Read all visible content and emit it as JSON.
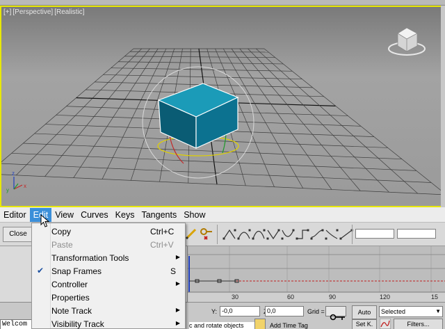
{
  "viewport": {
    "label_parts": [
      "[+]",
      "[Perspective]",
      "[Realistic]"
    ]
  },
  "menubar": {
    "items": [
      "Editor",
      "Edit",
      "View",
      "Curves",
      "Keys",
      "Tangents",
      "Show"
    ],
    "active": "Edit"
  },
  "toolbar": {
    "close_label": "Close"
  },
  "edit_menu": {
    "items": [
      {
        "label": "Copy",
        "shortcut": "Ctrl+C",
        "enabled": true
      },
      {
        "label": "Paste",
        "shortcut": "Ctrl+V",
        "enabled": false
      },
      {
        "label": "Transformation Tools",
        "shortcut": "",
        "enabled": true,
        "submenu": true
      },
      {
        "label": "Snap Frames",
        "shortcut": "S",
        "enabled": true,
        "checked": true
      },
      {
        "label": "Controller",
        "shortcut": "",
        "enabled": true,
        "submenu": true
      },
      {
        "label": "Properties",
        "shortcut": "",
        "enabled": true
      },
      {
        "label": "Note Track",
        "shortcut": "",
        "enabled": true,
        "submenu": true
      },
      {
        "label": "Visibility Track",
        "shortcut": "",
        "enabled": true,
        "submenu": true
      }
    ]
  },
  "timeline": {
    "ticks": [
      "30",
      "60",
      "90",
      "120",
      "15"
    ]
  },
  "status": {
    "welcome": "Welcom",
    "y_label": "Y:",
    "y_value": "-0,0",
    "z_label": "Z:",
    "z_value": "0,0",
    "grid_label": "Grid =",
    "prompt": "c and rotate objects",
    "add_time_tag": "Add Time Tag",
    "auto_label": "Auto",
    "setk_label": "Set K.",
    "selected_value": "Selected",
    "filters_label": "Filters..."
  },
  "colors": {
    "accent": "#3b8fd9",
    "viewport_border": "#e8e800",
    "box_color": "#0a8aa6"
  },
  "icons": [
    "checkmark-icon",
    "submenu-arrow-icon",
    "key-icon",
    "pencil-icon",
    "viewcube-icon",
    "axis-tripod-icon",
    "curve-icon"
  ]
}
